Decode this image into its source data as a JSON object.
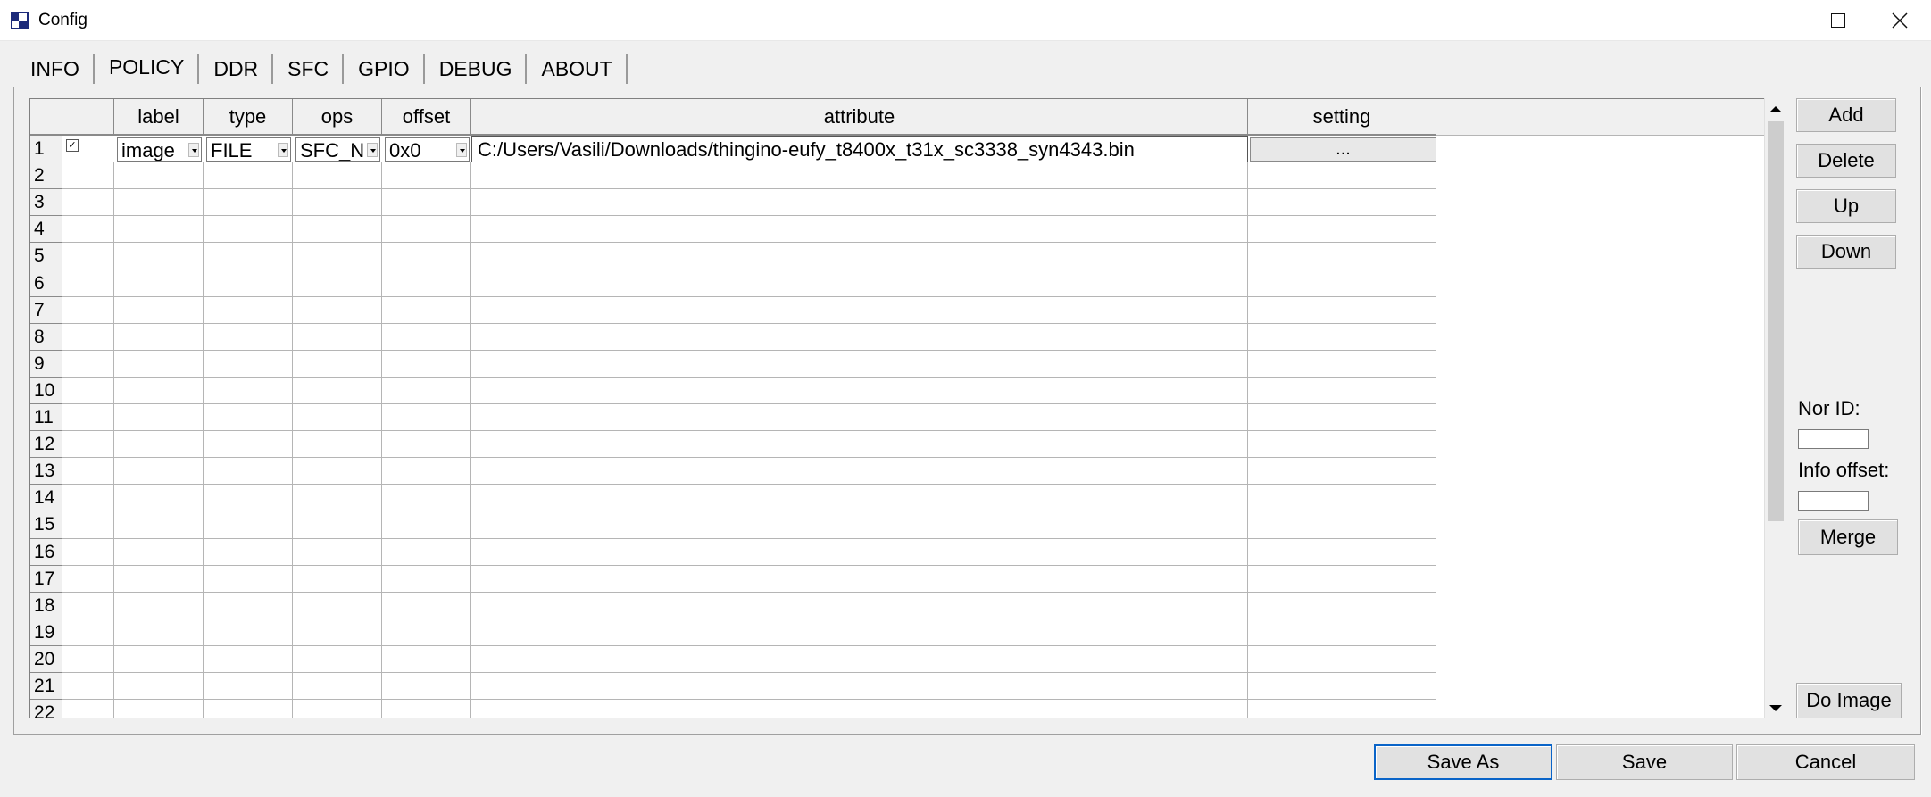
{
  "window": {
    "title": "Config",
    "minimize_icon": "minimize-icon",
    "maximize_icon": "maximize-icon",
    "close_icon": "close-icon"
  },
  "tabs": [
    {
      "label": "INFO"
    },
    {
      "label": "POLICY"
    },
    {
      "label": "DDR"
    },
    {
      "label": "SFC"
    },
    {
      "label": "GPIO"
    },
    {
      "label": "DEBUG"
    },
    {
      "label": "ABOUT"
    }
  ],
  "active_tab": "POLICY",
  "grid": {
    "columns": [
      "",
      "label",
      "type",
      "ops",
      "offset",
      "attribute",
      "setting"
    ],
    "row_numbers": [
      "1",
      "2",
      "3",
      "4",
      "5",
      "6",
      "7",
      "8",
      "9",
      "10",
      "11",
      "12",
      "13",
      "14",
      "15",
      "16",
      "17",
      "18",
      "19",
      "20",
      "21",
      "22"
    ],
    "row1": {
      "checked": true,
      "label": "image",
      "type": "FILE",
      "ops": "SFC_N",
      "offset": "0x0",
      "attribute": "C:/Users/Vasili/Downloads/thingino-eufy_t8400x_t31x_sc3338_syn4343.bin",
      "setting": "..."
    }
  },
  "sidebar": {
    "add_label": "Add",
    "delete_label": "Delete",
    "up_label": "Up",
    "down_label": "Down",
    "nor_id_label": "Nor ID:",
    "nor_id_value": "",
    "info_offset_label": "Info offset:",
    "info_offset_value": "",
    "merge_label": "Merge",
    "do_image_label": "Do Image"
  },
  "footer": {
    "save_as_label": "Save As",
    "save_label": "Save",
    "cancel_label": "Cancel"
  },
  "colors": {
    "app_icon": "#1c2a7a",
    "background": "#f0f0f0",
    "default_button_border": "#0a64c8"
  }
}
